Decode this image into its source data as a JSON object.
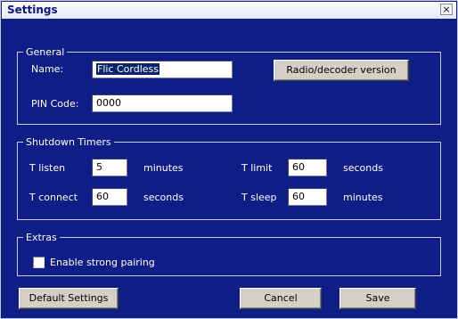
{
  "window": {
    "title": "Settings",
    "close_glyph": "×"
  },
  "general": {
    "legend": "General",
    "name_label": "Name:",
    "name_value": "Flic Cordless",
    "pin_label": "PIN Code:",
    "pin_value": "0000",
    "version_button": "Radio/decoder version"
  },
  "shutdown": {
    "legend": "Shutdown Timers",
    "t_listen": {
      "label": "T listen",
      "value": "5",
      "unit": "minutes"
    },
    "t_connect": {
      "label": "T connect",
      "value": "60",
      "unit": "seconds"
    },
    "t_limit": {
      "label": "T limit",
      "value": "60",
      "unit": "seconds"
    },
    "t_sleep": {
      "label": "T sleep",
      "value": "60",
      "unit": "minutes"
    }
  },
  "extras": {
    "legend": "Extras",
    "strong_pairing_label": "Enable strong pairing",
    "strong_pairing_checked": false
  },
  "footer": {
    "default_button": "Default Settings",
    "cancel_button": "Cancel",
    "save_button": "Save"
  },
  "colors": {
    "background": "#0e1e86",
    "selection": "#0a246a"
  }
}
